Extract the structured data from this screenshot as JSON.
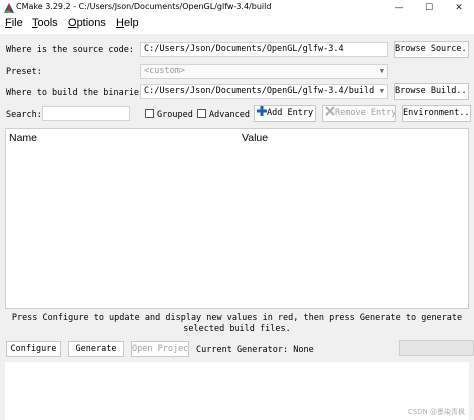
{
  "window": {
    "title": "CMake 3.29.2 - C:/Users/Json/Documents/OpenGL/glfw-3.4/build",
    "minimize": "—",
    "maximize": "☐",
    "close": "✕"
  },
  "menu": [
    {
      "pre": "",
      "ul": "F",
      "post": "ile"
    },
    {
      "pre": "",
      "ul": "T",
      "post": "ools"
    },
    {
      "pre": "",
      "ul": "O",
      "post": "ptions"
    },
    {
      "pre": "",
      "ul": "H",
      "post": "elp"
    }
  ],
  "source": {
    "label": "Where is the source code:",
    "value": "C:/Users/Json/Documents/OpenGL/glfw-3.4",
    "browse": "Browse Source..."
  },
  "preset": {
    "label": "Preset:",
    "value": "<custom>"
  },
  "binaries": {
    "label": "Where to build the binaries:",
    "value": "C:/Users/Json/Documents/OpenGL/glfw-3.4/build",
    "browse": "Browse Build..."
  },
  "search": {
    "label": "Search:",
    "value": "",
    "grouped": "Grouped",
    "advanced": "Advanced",
    "add_entry": "Add Entry",
    "remove_entry": "Remove Entry",
    "environment": "Environment..."
  },
  "table": {
    "columns": [
      "Name",
      "Value"
    ]
  },
  "message": "Press Configure to update and display new values in red, then press Generate to generate selected build files.",
  "actions": {
    "configure": "Configure",
    "generate": "Generate",
    "open_project": "Open Project",
    "current_generator": "Current Generator: None"
  },
  "watermark": "CSDN @墨染青枫",
  "colors": {
    "accent_blue": "#1a5fb4",
    "disabled_gray": "#a0a0a0"
  }
}
